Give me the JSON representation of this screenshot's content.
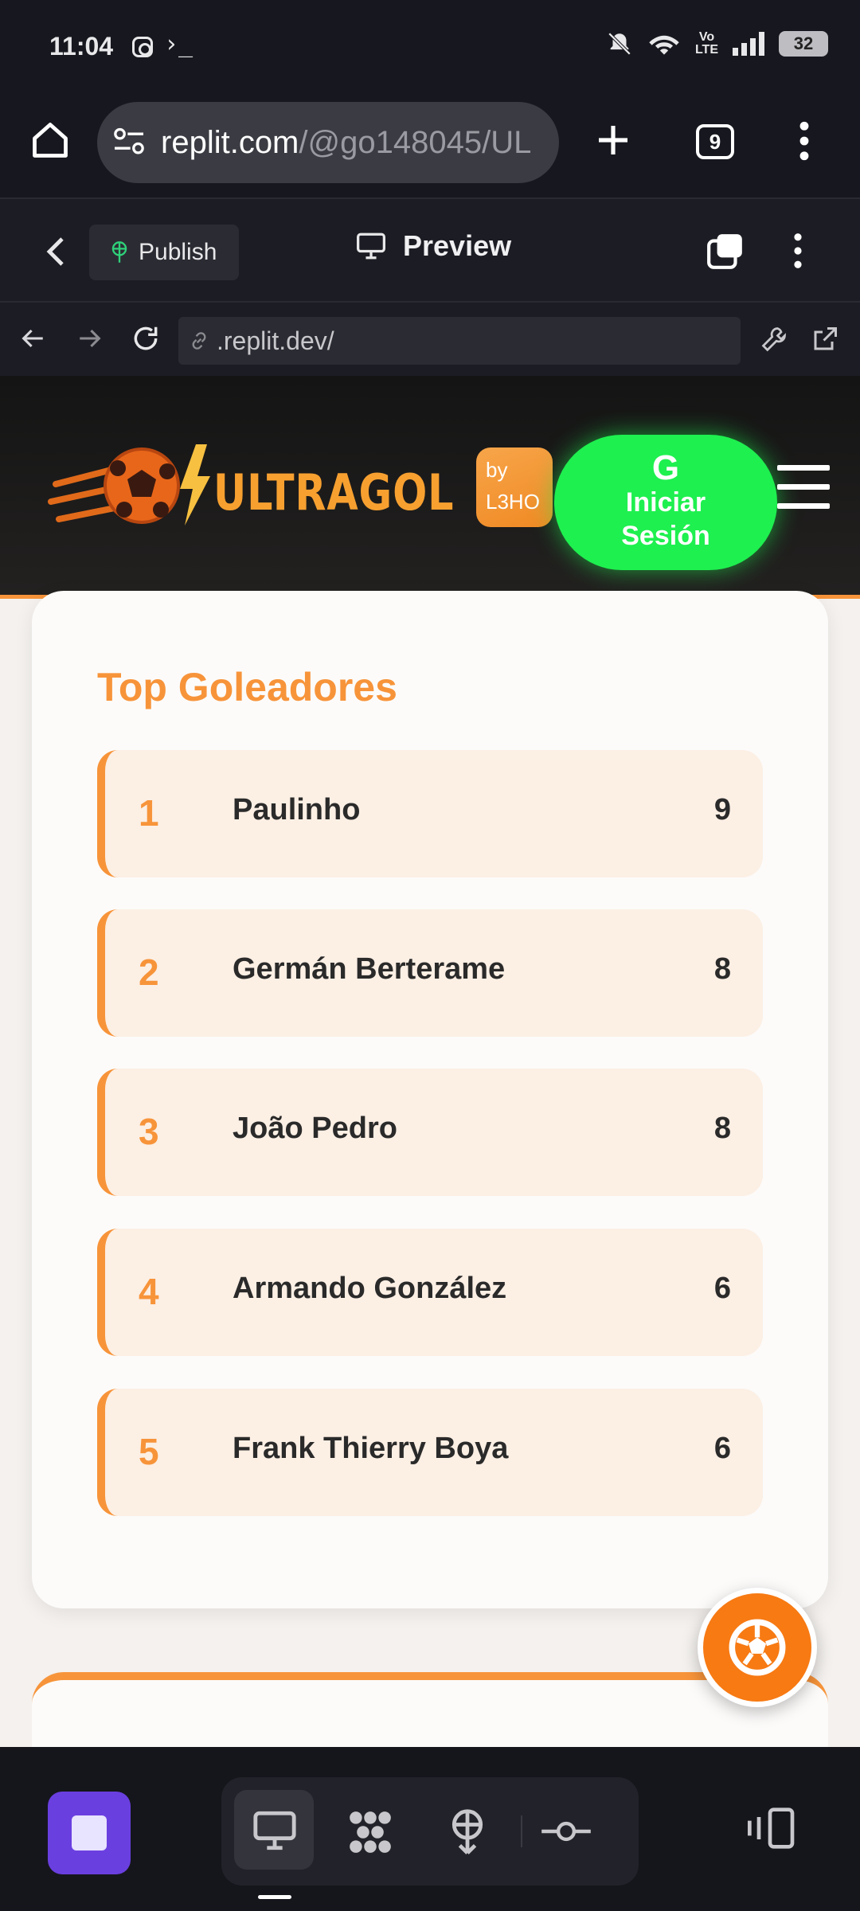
{
  "status_bar": {
    "time": "11:04",
    "terminal": "›_",
    "volte": "Vo\nLTE",
    "battery": "32"
  },
  "browser": {
    "url_host": "replit.com",
    "url_path": "/@go148045/UL",
    "tab_count": "9"
  },
  "replit_bar": {
    "publish_label": "Publish",
    "preview_label": "Preview"
  },
  "address_bar": {
    "url": ".replit.dev/"
  },
  "site": {
    "logo": "ULTRAGOL",
    "by_badge": "by L3HO",
    "login_icon": "G",
    "login_label_1": "Iniciar",
    "login_label_2": "Sesión"
  },
  "top_scorers": {
    "title": "Top Goleadores",
    "rows": [
      {
        "rank": "1",
        "name": "Paulinho",
        "goals": "9"
      },
      {
        "rank": "2",
        "name": "Germán Berterame",
        "goals": "8"
      },
      {
        "rank": "3",
        "name": "João Pedro",
        "goals": "8"
      },
      {
        "rank": "4",
        "name": "Armando González",
        "goals": "6"
      },
      {
        "rank": "5",
        "name": "Frank Thierry Boya",
        "goals": "6"
      }
    ]
  },
  "colors": {
    "accent": "#f7943a",
    "login": "#1ef04f",
    "stop": "#6a3fe0"
  }
}
